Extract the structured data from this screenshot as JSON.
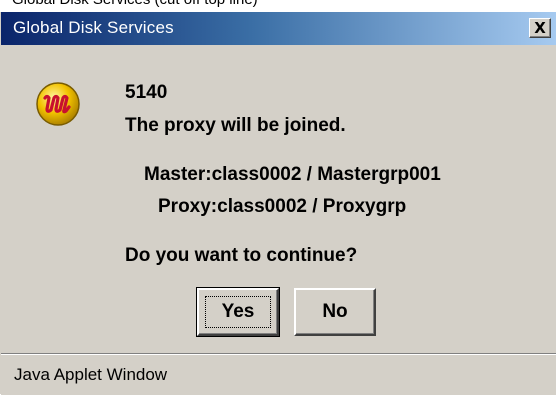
{
  "background": {
    "partial_text": "Global Disk Services (cut off top line)"
  },
  "window": {
    "title": "Global Disk Services",
    "close_glyph": "X",
    "close_icon": "close-icon"
  },
  "message": {
    "icon": "app-logo-icon",
    "code": "5140",
    "text": "The proxy will be joined.",
    "master": "Master:class0002 / Mastergrp001",
    "proxy": "Proxy:class0002 / Proxygrp",
    "question": "Do you want to continue?"
  },
  "buttons": {
    "yes": "Yes",
    "no": "No"
  },
  "status": {
    "text": "Java Applet Window"
  },
  "colors": {
    "titlebar_start": "#0a246a",
    "titlebar_end": "#a6caf0",
    "dialog_bg": "#d4d0c8",
    "icon_gold": "#f2c200",
    "icon_red": "#c8102e"
  }
}
